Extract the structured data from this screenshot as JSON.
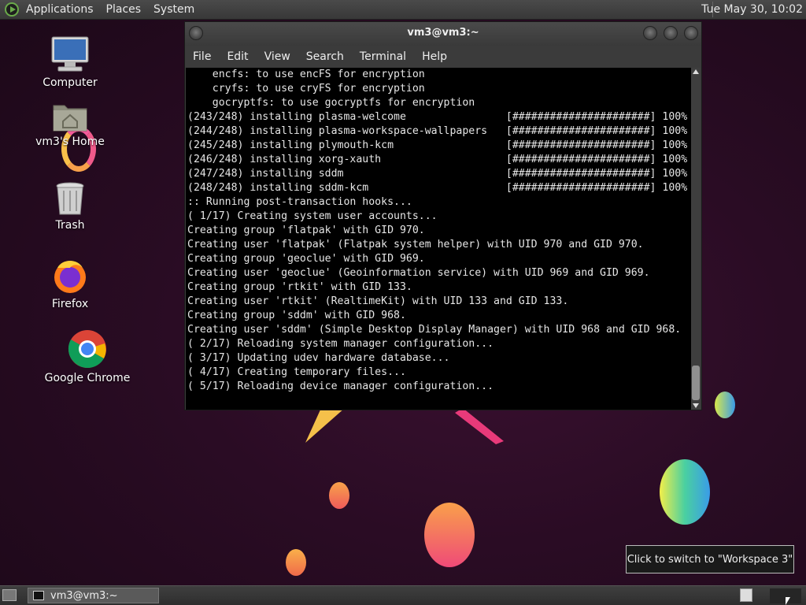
{
  "top_panel": {
    "menus": [
      "Applications",
      "Places",
      "System"
    ],
    "clock": "Tue May 30, 10:02"
  },
  "desktop_icons": {
    "computer": "Computer",
    "home": "vm3's Home",
    "trash": "Trash",
    "firefox": "Firefox",
    "chrome": "Google Chrome"
  },
  "terminal": {
    "title": "vm3@vm3:~",
    "menu": [
      "File",
      "Edit",
      "View",
      "Search",
      "Terminal",
      "Help"
    ],
    "lines": [
      "    encfs: to use encFS for encryption",
      "    cryfs: to use cryFS for encryption",
      "    gocryptfs: to use gocryptfs for encryption",
      "(243/248) installing plasma-welcome                [######################] 100%",
      "(244/248) installing plasma-workspace-wallpapers   [######################] 100%",
      "(245/248) installing plymouth-kcm                  [######################] 100%",
      "(246/248) installing xorg-xauth                    [######################] 100%",
      "(247/248) installing sddm                          [######################] 100%",
      "(248/248) installing sddm-kcm                      [######################] 100%",
      ":: Running post-transaction hooks...",
      "( 1/17) Creating system user accounts...",
      "Creating group 'flatpak' with GID 970.",
      "Creating user 'flatpak' (Flatpak system helper) with UID 970 and GID 970.",
      "Creating group 'geoclue' with GID 969.",
      "Creating user 'geoclue' (Geoinformation service) with UID 969 and GID 969.",
      "Creating group 'rtkit' with GID 133.",
      "Creating user 'rtkit' (RealtimeKit) with UID 133 and GID 133.",
      "Creating group 'sddm' with GID 968.",
      "Creating user 'sddm' (Simple Desktop Display Manager) with UID 968 and GID 968.",
      "( 2/17) Reloading system manager configuration...",
      "( 3/17) Updating udev hardware database...",
      "( 4/17) Creating temporary files...",
      "( 5/17) Reloading device manager configuration..."
    ]
  },
  "tooltip": "Click to switch to \"Workspace 3\"",
  "taskbar": {
    "task_label": "vm3@vm3:~"
  }
}
